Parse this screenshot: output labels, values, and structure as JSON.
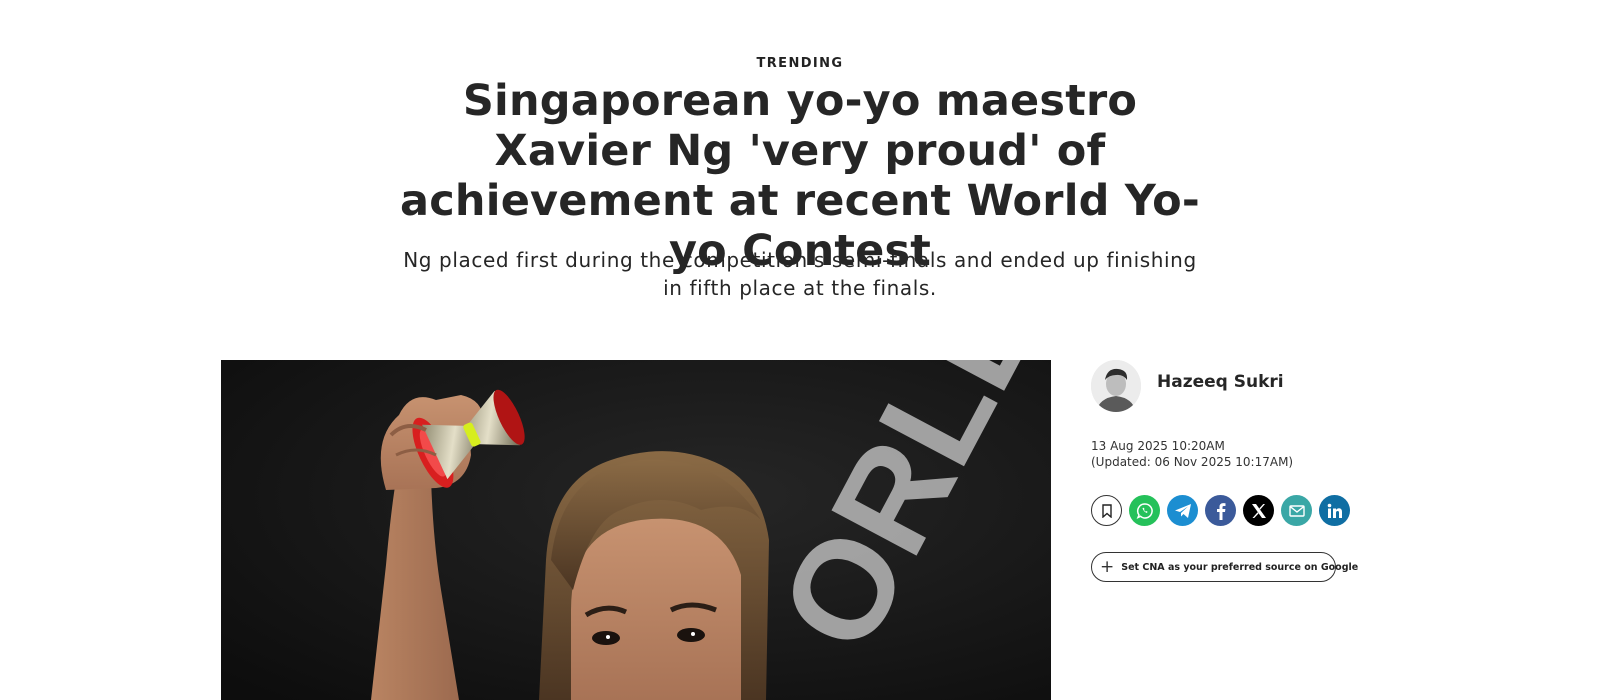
{
  "article": {
    "kicker": "TRENDING",
    "headline": "Singaporean yo-yo maestro Xavier Ng 'very proud' of achievement at recent World Yo-yo Contest",
    "standfirst": "Ng placed first during the competition's semi-finals and ended up finishing in fifth place at the finals."
  },
  "hero_image": {
    "description_icon": "hero-photo",
    "backdrop_text": "ORLD Y"
  },
  "byline": {
    "author_name": "Hazeeq Sukri",
    "published": "13 Aug 2025 10:20AM",
    "updated": "(Updated: 06 Nov 2025 10:17AM)"
  },
  "share": [
    {
      "name": "bookmark-button",
      "icon": "bookmark-icon"
    },
    {
      "name": "whatsapp-share-button",
      "icon": "whatsapp-icon",
      "color": "#25c15a"
    },
    {
      "name": "telegram-share-button",
      "icon": "telegram-icon",
      "color": "#1c8ed1"
    },
    {
      "name": "facebook-share-button",
      "icon": "facebook-icon",
      "color": "#3b5a9a"
    },
    {
      "name": "x-share-button",
      "icon": "x-icon",
      "color": "#000000"
    },
    {
      "name": "email-share-button",
      "icon": "email-icon",
      "color": "#3aa7a6"
    },
    {
      "name": "linkedin-share-button",
      "icon": "linkedin-icon",
      "color": "#0f6ea3"
    }
  ],
  "preferred_source": {
    "label": "Set CNA as your preferred source on Google",
    "icon": "plus-icon"
  }
}
